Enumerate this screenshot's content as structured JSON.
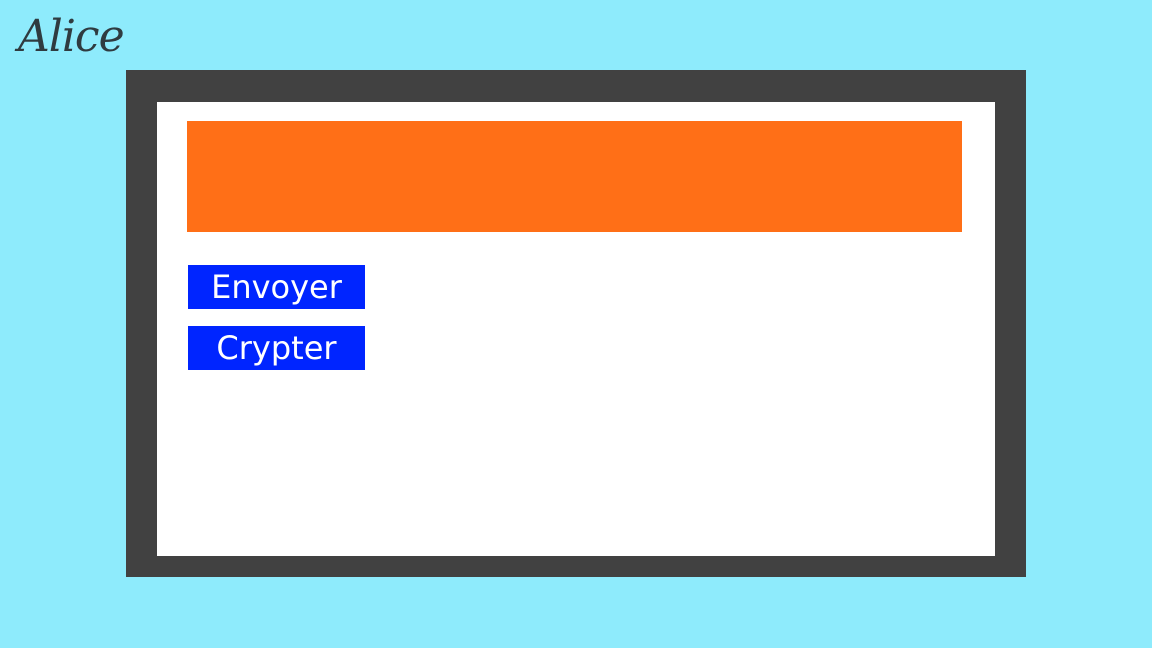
{
  "user": {
    "name": "Alice"
  },
  "colors": {
    "background": "#8eebfc",
    "frame": "#414141",
    "screen": "#ffffff",
    "message_area": "#ff6f17",
    "button": "#0025ff",
    "button_text": "#ffffff",
    "name_text": "#2f3b40"
  },
  "buttons": {
    "send_label": "Envoyer",
    "encrypt_label": "Crypter"
  }
}
